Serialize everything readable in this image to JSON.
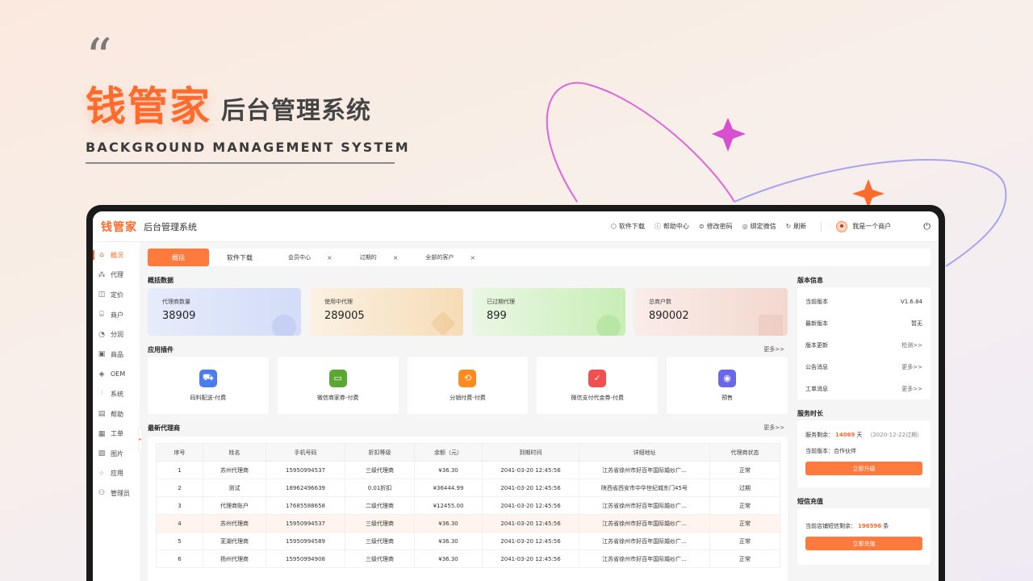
{
  "hero": {
    "quote_mark": "“",
    "brand": "钱管家",
    "subtitle": "后台管理系统",
    "english": "BACKGROUND MANAGEMENT SYSTEM"
  },
  "colors": {
    "accent": "#ff6b2c",
    "button": "#ff7a3d"
  },
  "topbar": {
    "logo": "钱管家",
    "title": "后台管理系统",
    "actions": [
      {
        "icon": "download-icon",
        "label": "软件下载"
      },
      {
        "icon": "help-icon",
        "label": "帮助中心"
      },
      {
        "icon": "lock-icon",
        "label": "修改密码"
      },
      {
        "icon": "wechat-icon",
        "label": "绑定微信"
      },
      {
        "icon": "refresh-icon",
        "label": "刷新"
      }
    ],
    "user": "我是一个商户"
  },
  "sidebar": {
    "items": [
      {
        "icon": "home-icon",
        "label": "概况"
      },
      {
        "icon": "agent-icon",
        "label": "代理"
      },
      {
        "icon": "price-icon",
        "label": "定价"
      },
      {
        "icon": "store-icon",
        "label": "商户"
      },
      {
        "icon": "pie-icon",
        "label": "分润"
      },
      {
        "icon": "product-icon",
        "label": "商品"
      },
      {
        "icon": "oem-icon",
        "label": "OEM"
      },
      {
        "icon": "settings-icon",
        "label": "系统"
      },
      {
        "icon": "help-icon",
        "label": "帮助"
      },
      {
        "icon": "ticket-icon",
        "label": "工单"
      },
      {
        "icon": "image-icon",
        "label": "图片"
      },
      {
        "icon": "apps-icon",
        "label": "应用"
      },
      {
        "icon": "admin-icon",
        "label": "管理员"
      }
    ]
  },
  "tabs": [
    {
      "label": "概括",
      "active": true
    },
    {
      "label": "软件下载"
    },
    {
      "label": "会员中心",
      "closable": true
    },
    {
      "label": "过期的",
      "closable": true
    },
    {
      "label": "全部的客户",
      "closable": true
    }
  ],
  "overview": {
    "title": "概括数据",
    "stats": [
      {
        "label": "代理商数量",
        "value": "38909"
      },
      {
        "label": "使用中代理",
        "value": "289005"
      },
      {
        "label": "已过期代理",
        "value": "899"
      },
      {
        "label": "总商户数",
        "value": "890002"
      }
    ]
  },
  "plugins": {
    "title": "应用插件",
    "more": "更多>>",
    "items": [
      {
        "label": "码料配送-付费",
        "icon": "truck-icon",
        "color": "#4a7cf0"
      },
      {
        "label": "微信商家券-付费",
        "icon": "coupon-icon",
        "color": "#5aa832"
      },
      {
        "label": "分销付费-付费",
        "icon": "share-icon",
        "color": "#ff8a1f"
      },
      {
        "label": "微信支付代金券-付费",
        "icon": "voucher-icon",
        "color": "#f25050"
      },
      {
        "label": "预售",
        "icon": "presale-icon",
        "color": "#6a67ea"
      }
    ]
  },
  "agents": {
    "title": "最新代理商",
    "more": "更多>>",
    "columns": [
      "序号",
      "姓名",
      "手机号码",
      "折扣等级",
      "余额（元）",
      "到期时间",
      "详细地址",
      "代理商状态"
    ],
    "rows": [
      [
        "1",
        "苏州代理商",
        "15950994537",
        "三级代理商",
        "¥36.30",
        "2041-03-20 12:45:56",
        "江苏省徐州市好百年国际婚纱广...",
        "正常"
      ],
      [
        "2",
        "测试",
        "18962496639",
        "0.01折扣",
        "¥36444.99",
        "2041-03-20 12:45:56",
        "陕西省西安市中华世纪城东门45号",
        "过期"
      ],
      [
        "3",
        "代理商账户",
        "17685588658",
        "二级代理商",
        "¥12455.00",
        "2041-03-20 12:45:56",
        "江苏省徐州市好百年国际婚纱广...",
        "正常"
      ],
      [
        "4",
        "苏州代理商",
        "15950994537",
        "三级代理商",
        "¥36.30",
        "2041-03-20 12:45:56",
        "江苏省徐州市好百年国际婚纱广...",
        "正常"
      ],
      [
        "5",
        "芜湖代理商",
        "15950994589",
        "三级代理商",
        "¥36.30",
        "2041-03-20 12:45:56",
        "江苏省徐州市好百年国际婚纱广...",
        "正常"
      ],
      [
        "6",
        "扬州代理商",
        "15950994908",
        "三级代理商",
        "¥36.30",
        "2041-03-20 12:45:56",
        "江苏省徐州市好百年国际婚纱广...",
        "正常"
      ]
    ]
  },
  "version": {
    "title": "版本信息",
    "rows": [
      {
        "label": "当前版本",
        "value": "V1.6.84"
      },
      {
        "label": "最新版本",
        "value": "暂无"
      },
      {
        "label": "版本更新",
        "value": "检测>>"
      },
      {
        "label": "公告消息",
        "value": "更多>>"
      },
      {
        "label": "工单消息",
        "value": "更多>>"
      }
    ]
  },
  "service": {
    "title": "服务时长",
    "remaining_label": "服务剩余：",
    "remaining_days": "14069",
    "days_unit": "天",
    "expiry": "（2020-12-22过期）",
    "version_line": "当前版本：合作伙伴",
    "upgrade_button": "立即升级"
  },
  "sms": {
    "title": "短信充值",
    "remaining_label": "当前店铺短信剩余：",
    "remaining_count": "196596",
    "count_unit": "条",
    "recharge_button": "立即充值"
  }
}
